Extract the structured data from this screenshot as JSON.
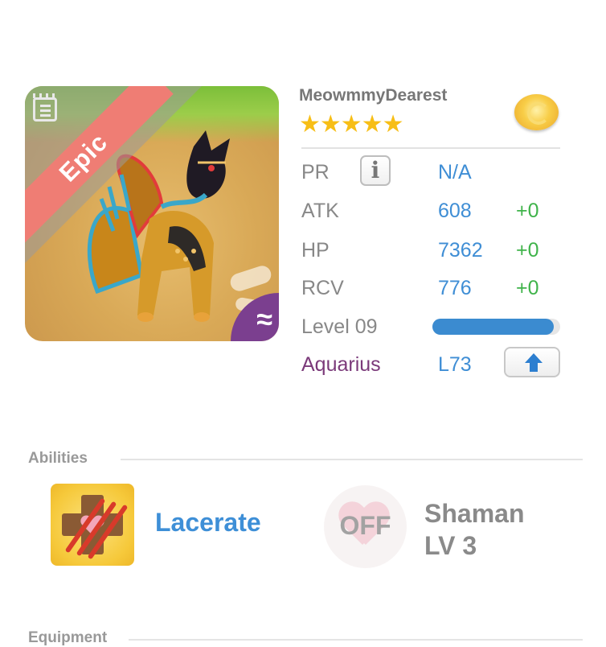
{
  "pet": {
    "rarity": "Epic",
    "element_badge": "≈"
  },
  "profile": {
    "name": "MeowmmyDearest",
    "stars": "★★★★★",
    "star_count": 5
  },
  "stats": {
    "pr": {
      "label": "PR",
      "info": "i",
      "value": "N/A"
    },
    "atk": {
      "label": "ATK",
      "value": "608",
      "bonus": "+0"
    },
    "hp": {
      "label": "HP",
      "value": "7362",
      "bonus": "+0"
    },
    "rcv": {
      "label": "RCV",
      "value": "776",
      "bonus": "+0"
    },
    "level": {
      "label": "Level 09",
      "progress": 0.95
    },
    "sign": {
      "label": "Aquarius",
      "value": "L73"
    }
  },
  "colors": {
    "value_blue": "#3f8ed5",
    "bonus_green": "#3fb34a",
    "sign_purple": "#7b3a7a",
    "epic_ribbon": "#ef7d74"
  },
  "abilities": {
    "title": "Abilities",
    "primary": {
      "name": "Lacerate",
      "icon": "lacerate-icon"
    },
    "secondary": {
      "status": "OFF",
      "name_line1": "Shaman",
      "name_line2": "LV 3",
      "icon": "heart-claw-icon"
    }
  },
  "equipment": {
    "title": "Equipment"
  }
}
